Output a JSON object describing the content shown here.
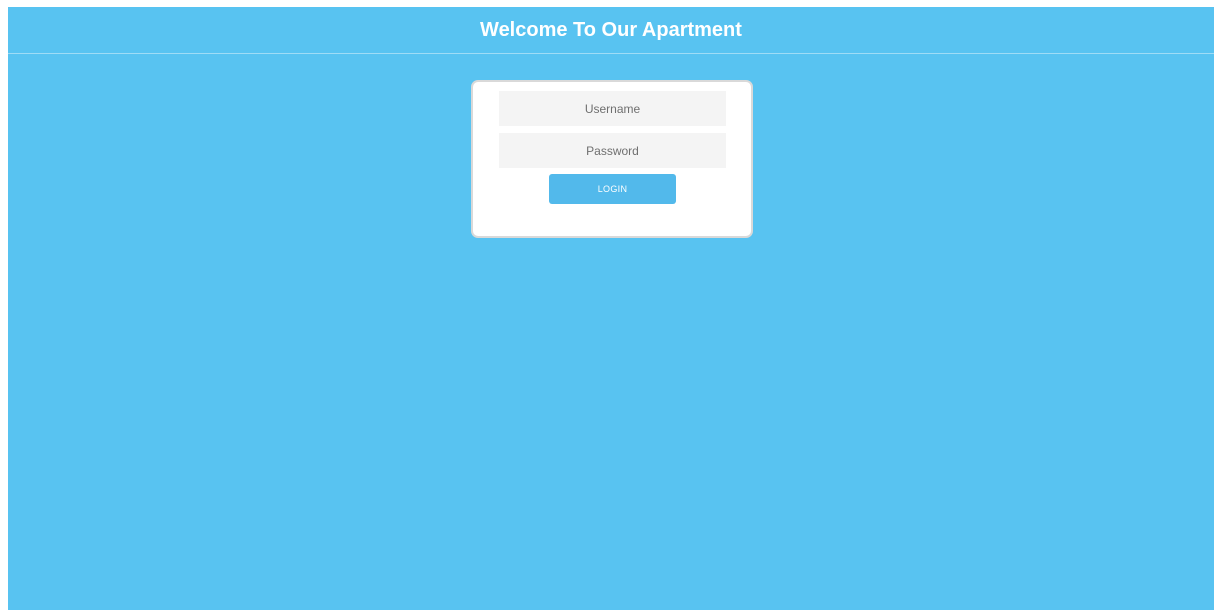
{
  "header": {
    "title": "Welcome To Our Apartment"
  },
  "login_form": {
    "username": {
      "value": "",
      "placeholder": "Username"
    },
    "password": {
      "value": "",
      "placeholder": "Password"
    },
    "login_label": "LOGIN"
  },
  "colors": {
    "page_background": "#58c3f1",
    "card_background": "#ffffff",
    "input_background": "#f4f4f4",
    "button_background": "#52b9eb"
  }
}
